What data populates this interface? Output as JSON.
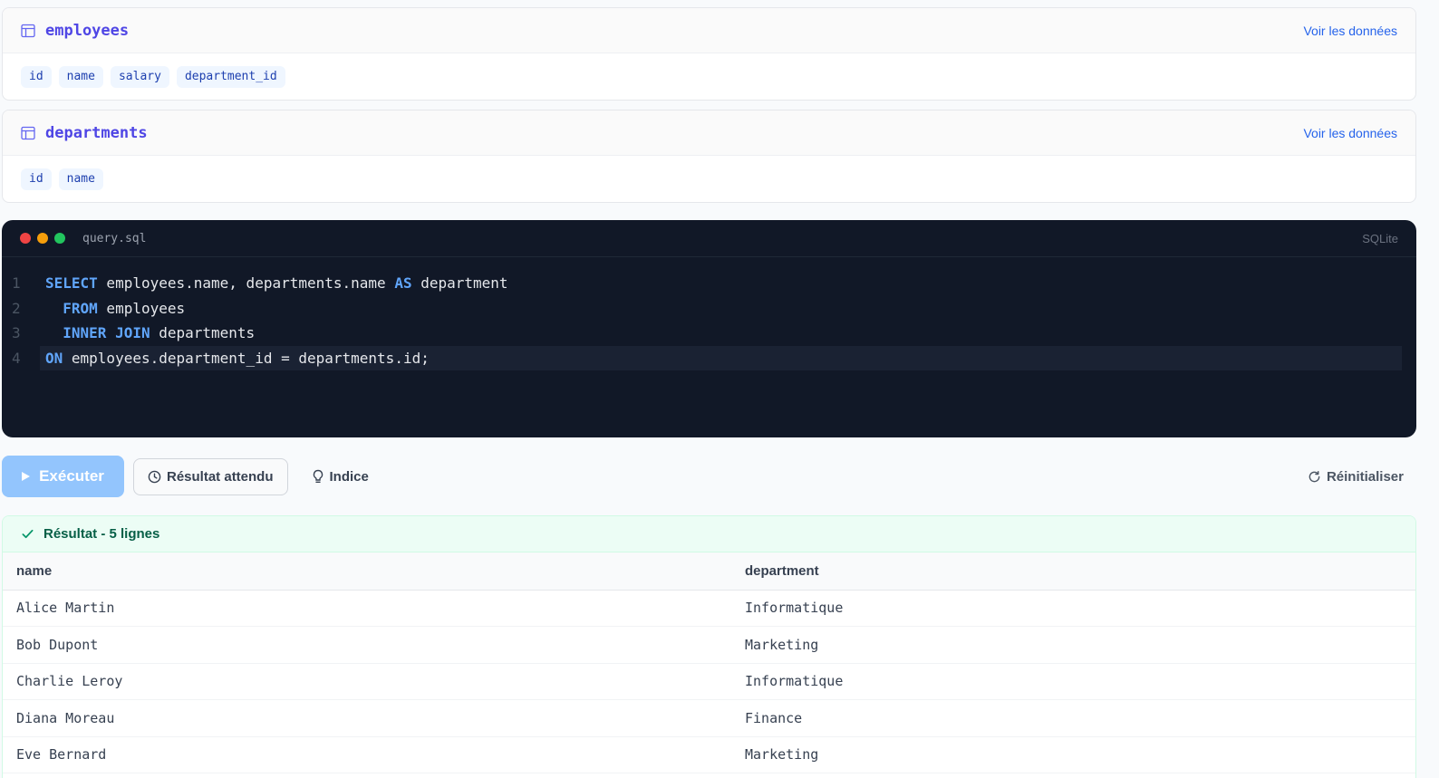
{
  "schema": {
    "view_data_label": "Voir les données",
    "tables": [
      {
        "name": "employees",
        "columns": [
          "id",
          "name",
          "salary",
          "department_id"
        ]
      },
      {
        "name": "departments",
        "columns": [
          "id",
          "name"
        ]
      }
    ]
  },
  "editor": {
    "filename": "query.sql",
    "language": "SQLite",
    "line_numbers": [
      "1",
      "2",
      "3",
      "4"
    ],
    "lines": [
      [
        {
          "t": "SELECT",
          "kw": true
        },
        {
          "t": " employees.name, departments.name "
        },
        {
          "t": "AS",
          "kw": true
        },
        {
          "t": " department"
        }
      ],
      [
        {
          "t": "  "
        },
        {
          "t": "FROM",
          "kw": true
        },
        {
          "t": " employees"
        }
      ],
      [
        {
          "t": "  "
        },
        {
          "t": "INNER JOIN",
          "kw": true
        },
        {
          "t": " departments"
        }
      ],
      [
        {
          "t": "ON",
          "kw": true
        },
        {
          "t": " employees.department_id = departments.id;"
        }
      ]
    ],
    "dot_colors": [
      "#ef4444",
      "#f59e0b",
      "#22c55e"
    ]
  },
  "toolbar": {
    "run_label": "Exécuter",
    "expected_label": "Résultat attendu",
    "hint_label": "Indice",
    "reset_label": "Réinitialiser"
  },
  "result": {
    "title": "Résultat - 5 lignes",
    "columns": [
      "name",
      "department"
    ],
    "rows": [
      [
        "Alice Martin",
        "Informatique"
      ],
      [
        "Bob Dupont",
        "Marketing"
      ],
      [
        "Charlie Leroy",
        "Informatique"
      ],
      [
        "Diana Moreau",
        "Finance"
      ],
      [
        "Eve Bernard",
        "Marketing"
      ]
    ]
  },
  "colors": {
    "accent": "#4f46e5",
    "link": "#2563eb",
    "keyword": "#60a5fa",
    "success": "#065f46"
  }
}
